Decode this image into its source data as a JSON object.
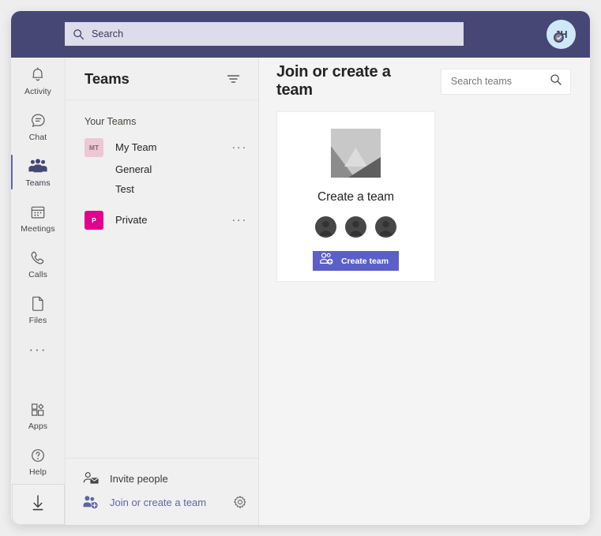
{
  "topbar": {
    "search_placeholder": "Search",
    "search_icon": "search-icon",
    "avatar_initials": "JH",
    "presence_icon": "available-check-icon"
  },
  "rail": {
    "items": [
      {
        "label": "Activity",
        "icon": "bell-icon",
        "active": false
      },
      {
        "label": "Chat",
        "icon": "chat-bubble-icon",
        "active": false
      },
      {
        "label": "Teams",
        "icon": "people-icon",
        "active": true
      },
      {
        "label": "Meetings",
        "icon": "calendar-icon",
        "active": false
      },
      {
        "label": "Calls",
        "icon": "phone-icon",
        "active": false
      },
      {
        "label": "Files",
        "icon": "file-icon",
        "active": false
      }
    ],
    "more_label": "···",
    "bottom_items": [
      {
        "label": "Apps",
        "icon": "apps-icon"
      },
      {
        "label": "Help",
        "icon": "help-circle-icon"
      }
    ],
    "download_icon": "download-arrow-icon"
  },
  "teams_panel": {
    "title": "Teams",
    "filter_icon": "filter-icon",
    "section_label": "Your Teams",
    "teams": [
      {
        "name": "My Team",
        "initials": "MT",
        "badge_bg": "#ecc7d4",
        "badge_fg": "#8b6472",
        "more_label": "···",
        "channels": [
          "General",
          "Test"
        ]
      },
      {
        "name": "Private",
        "initials": "P",
        "badge_bg": "#e3008c",
        "badge_fg": "#ffffff",
        "more_label": "···",
        "channels": []
      }
    ],
    "footer": {
      "invite_label": "Invite people",
      "invite_icon": "person-mail-icon",
      "join_label": "Join or create a team",
      "join_icon": "people-add-icon",
      "gear_icon": "gear-icon"
    }
  },
  "main": {
    "title": "Join or create a team",
    "search_placeholder": "Search teams",
    "search_icon": "search-icon",
    "card": {
      "title": "Create a team",
      "art_icon": "mountain-landscape-icon",
      "button_label": "Create team",
      "button_icon": "people-add-icon",
      "people_count": 3
    }
  },
  "colors": {
    "topbar_bg": "#464775",
    "accent_purple": "#6264a7",
    "button_purple": "#5b5fc7",
    "window_bg": "#f3f2f1",
    "panel_bg": "#f0f0f0",
    "main_bg": "#f4f4f4",
    "private_magenta": "#e3008c"
  }
}
